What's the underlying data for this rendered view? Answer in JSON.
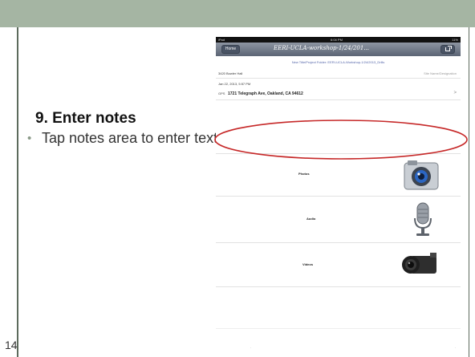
{
  "slide": {
    "title": "9. Enter notes",
    "bullet": "Tap notes area to enter text",
    "number": "14"
  },
  "ipad": {
    "status": {
      "carrier": "iPad",
      "time": "6:04 PM",
      "battery": "11%"
    },
    "nav": {
      "home": "Home",
      "title": "EERI-UCLA-workshop-1/24/201..."
    },
    "folder_line": "New Title/Project Folder: EERI-UCLA-Workshop-1/24/2013_Drills",
    "building": "3420 Bowler Hall",
    "building_hint": "Site Name/Designation",
    "date": "Jan 22, 2013, 5:57 PM",
    "gps": "GPS",
    "address": "1721 Telegraph Ave, Oakland, CA 94612",
    "chevron": ">",
    "media": [
      {
        "label": "Photos",
        "icon": "camera-icon"
      },
      {
        "label": "Audio",
        "icon": "microphone-icon"
      },
      {
        "label": "Videos",
        "icon": "video-camera-icon"
      }
    ],
    "dot": "."
  },
  "colors": {
    "top_bar": "#a5b5a3",
    "rule": "#5d6b5d",
    "callout": "#c62828"
  }
}
